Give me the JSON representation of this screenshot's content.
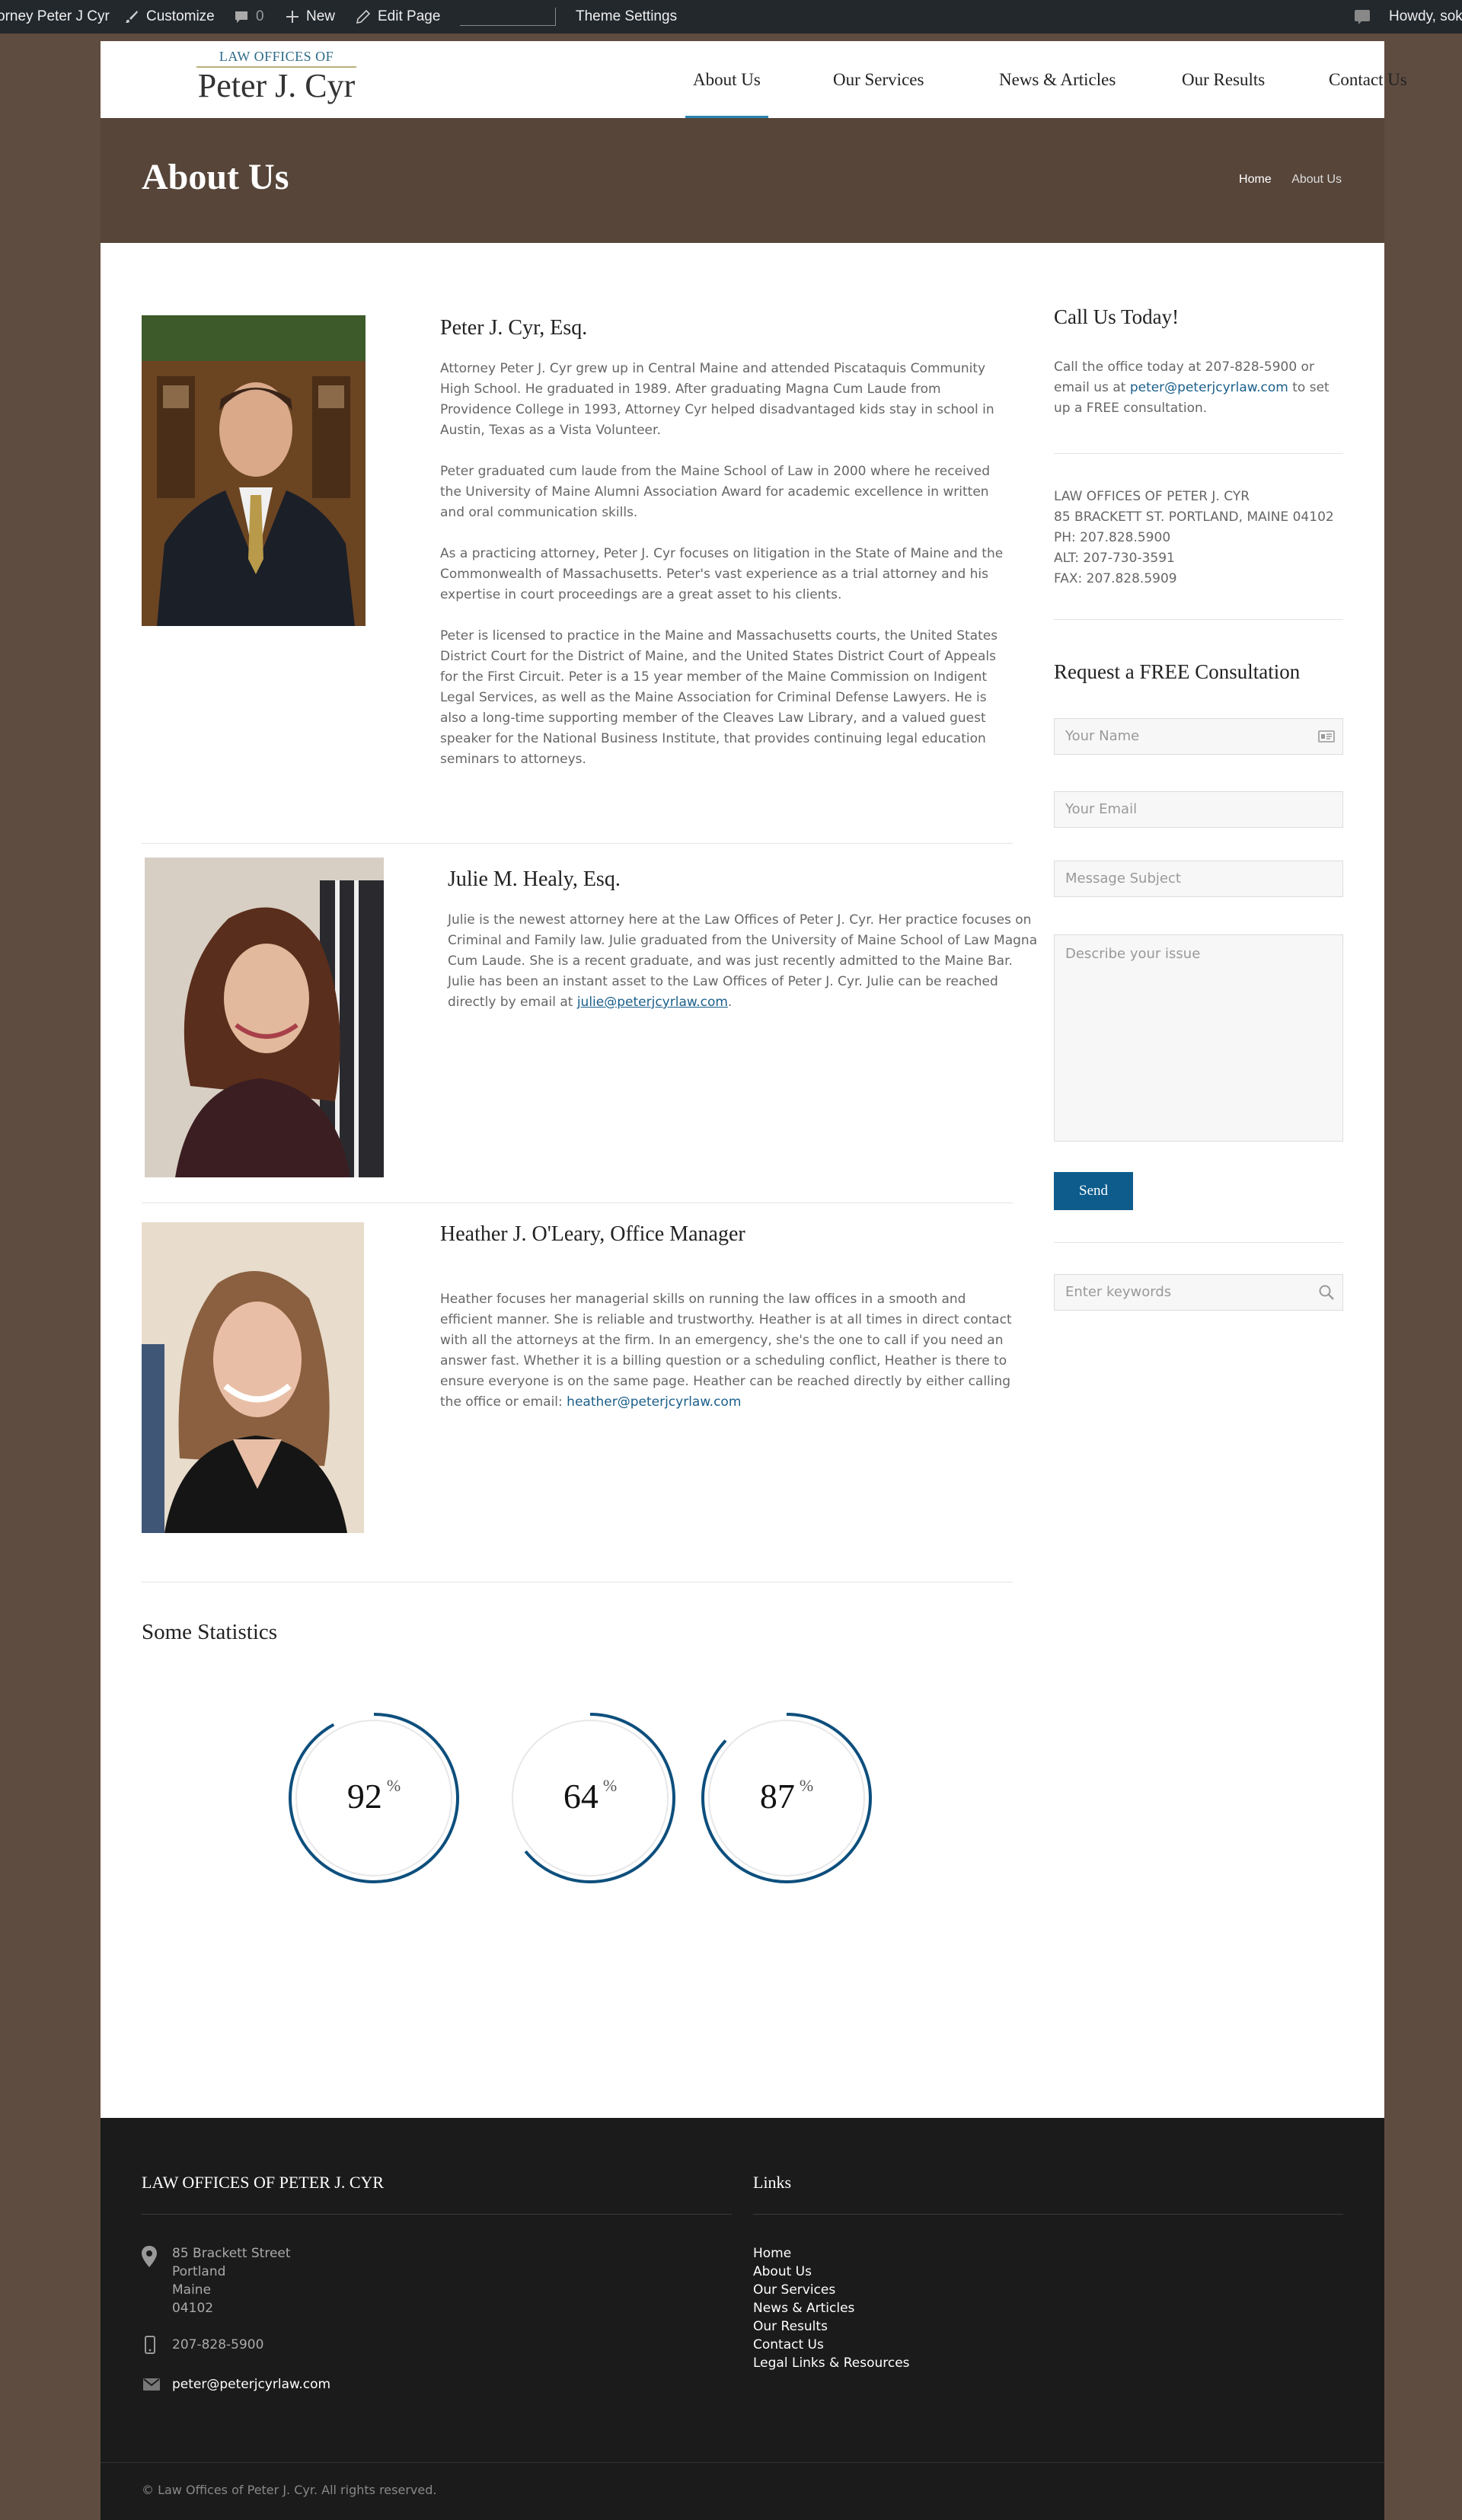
{
  "admin_bar": {
    "site_name": "orney Peter J Cyr",
    "customize": "Customize",
    "comments_count": "0",
    "new": "New",
    "edit_page": "Edit Page",
    "theme_settings": "Theme Settings",
    "howdy": "Howdy, sok"
  },
  "logo": {
    "line1": "LAW OFFICES OF",
    "line2": "Peter J. Cyr"
  },
  "nav": {
    "items": [
      {
        "label": "About Us"
      },
      {
        "label": "Our Services"
      },
      {
        "label": "News & Articles"
      },
      {
        "label": "Our Results"
      },
      {
        "label": "Contact Us"
      }
    ],
    "active": "About Us"
  },
  "page_title": "About Us",
  "breadcrumb": {
    "home": "Home",
    "current": "About Us"
  },
  "bios": [
    {
      "name": "Peter J. Cyr, Esq.",
      "paragraphs": [
        "Attorney Peter J. Cyr grew up in Central Maine and attended Piscataquis Community High School. He graduated in 1989. After graduating Magna Cum Laude from Providence College in 1993, Attorney Cyr helped disadvantaged kids stay in school in Austin, Texas as a Vista Volunteer.",
        "Peter graduated cum laude from the Maine School of Law in 2000 where he received the University of Maine Alumni Association Award for academic excellence in written and oral communication skills.",
        "As a practicing attorney, Peter J. Cyr focuses on litigation in the State of Maine and the Commonwealth of Massachusetts. Peter's vast experience as a trial attorney and his expertise in court proceedings are a great asset to his clients.",
        "Peter is licensed to practice in the Maine and Massachusetts courts, the United States District Court for the District of Maine, and the United States District Court of Appeals for the First Circuit. Peter is a 15 year member of the Maine Commission on Indigent Legal Services, as well as the Maine Association for Criminal Defense Lawyers. He is also a long-time supporting member of the Cleaves Law Library, and a valued guest speaker for the National Business Institute, that provides continuing legal education seminars to attorneys."
      ]
    },
    {
      "name": "Julie M. Healy, Esq.",
      "text": "Julie is the newest attorney here at the Law Offices of Peter J. Cyr. Her practice focuses on Criminal and Family law.  Julie graduated from the University of Maine School of Law Magna Cum Laude.  She is a recent graduate, and was just recently admitted to the Maine Bar.  Julie has been an instant asset to the Law Offices of Peter J. Cyr.  Julie can be reached directly by email at ",
      "email": "julie@peterjcyrlaw.com",
      "after": "."
    },
    {
      "name": "Heather J. O'Leary, Office Manager",
      "text": "Heather focuses her managerial skills on running the law offices in a smooth and efficient manner.  She is reliable and trustworthy.  Heather is at all times in direct contact with all the attorneys at the firm.  In an emergency, she's the one to call if you need an answer fast.  Whether it is a billing question or a scheduling conflict, Heather is there to ensure everyone is on the same page.   Heather can be reached directly by either calling the office or email: ",
      "email": "heather@peterjcyrlaw.com"
    }
  ],
  "statistics": {
    "title": "Some Statistics",
    "items": [
      {
        "value": 92,
        "unit": "%"
      },
      {
        "value": 64,
        "unit": "%"
      },
      {
        "value": 87,
        "unit": "%"
      }
    ],
    "ring_color": "#0d4f7d"
  },
  "sidebar": {
    "call_title": "Call Us Today!",
    "call_text": "Call the office today at 207-828-5900 or email us at ",
    "call_email": "peter@peterjcyrlaw.com",
    "call_text_after": " to set up a FREE consultation.",
    "address_lines": [
      "LAW OFFICES OF PETER J. CYR",
      "85 BRACKETT ST. PORTLAND, MAINE 04102",
      "PH: 207.828.5900",
      "ALT: 207-730-3591",
      "FAX: 207.828.5909"
    ],
    "form_title": "Request a FREE Consultation",
    "form": {
      "name_placeholder": "Your Name",
      "email_placeholder": "Your Email",
      "subject_placeholder": "Message Subject",
      "message_placeholder": "Describe your issue",
      "send_label": "Send"
    },
    "search_placeholder": "Enter keywords"
  },
  "footer": {
    "office_title": "LAW OFFICES OF PETER J. CYR",
    "address": [
      "85 Brackett Street",
      "Portland",
      "Maine",
      "04102"
    ],
    "phone": "207-828-5900",
    "email": "peter@peterjcyrlaw.com",
    "links_title": "Links",
    "links": [
      "Home",
      "About Us",
      "Our Services",
      "News & Articles",
      "Our Results",
      "Contact Us",
      "Legal Links & Resources"
    ],
    "copyright": "© Law Offices of Peter J. Cyr. All rights reserved."
  },
  "colors": {
    "brand_brown": "#574539",
    "accent_blue": "#0d5c8c",
    "footer_bg": "#1b1b1b"
  }
}
